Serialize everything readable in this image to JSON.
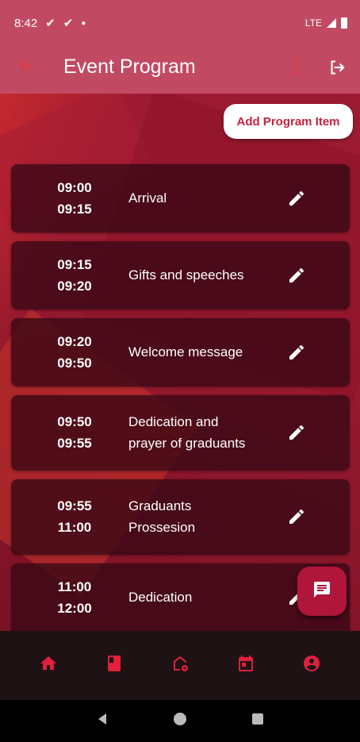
{
  "status_bar": {
    "time": "8:42",
    "network": "LTE"
  },
  "app_bar": {
    "title": "Event Program"
  },
  "actions": {
    "add_label": "Add Program Item"
  },
  "program_items": [
    {
      "start": "09:00",
      "end": "09:15",
      "title": "Arrival"
    },
    {
      "start": "09:15",
      "end": "09:20",
      "title": "Gifts and speeches"
    },
    {
      "start": "09:20",
      "end": "09:50",
      "title": "Welcome message"
    },
    {
      "start": "09:50",
      "end": "09:55",
      "title_lines": [
        "Dedication and",
        "prayer of graduants"
      ]
    },
    {
      "start": "09:55",
      "end": "11:00",
      "title_lines": [
        "Graduants",
        "Prossesion"
      ]
    },
    {
      "start": "11:00",
      "end": "12:00",
      "title": "Dedication"
    }
  ],
  "colors": {
    "accent": "#e53a3a",
    "app_bar": "#c14a62",
    "button_text": "#c8203e",
    "fab": "#b0163a",
    "nav_icons": "#e0203c"
  },
  "icons": {
    "back": "arrow-left-icon",
    "more": "more-vert-icon",
    "logout": "logout-icon",
    "edit": "pencil-icon",
    "fab": "chat-icon",
    "nav": [
      "home-icon",
      "book-icon",
      "add-home-icon",
      "calendar-icon",
      "account-circle-icon"
    ]
  }
}
